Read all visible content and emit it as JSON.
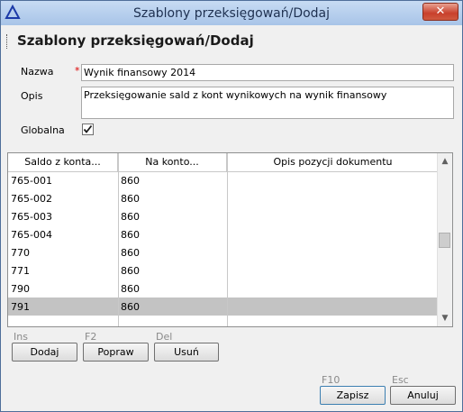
{
  "window": {
    "title": "Szablony przeksięgowań/Dodaj"
  },
  "page": {
    "title": "Szablony przeksięgowań/Dodaj"
  },
  "form": {
    "nazwa_label": "Nazwa",
    "required_mark": "*",
    "nazwa_value": "Wynik finansowy 2014",
    "opis_label": "Opis",
    "opis_value": "Przeksięgowanie sald z kont wynikowych na wynik finansowy",
    "globalna_label": "Globalna",
    "globalna_checked": true
  },
  "grid": {
    "columns": [
      "Saldo z konta...",
      "Na konto...",
      "Opis pozycji dokumentu"
    ],
    "rows": [
      {
        "saldo": "765-001",
        "na_konto": "860",
        "opis": ""
      },
      {
        "saldo": "765-002",
        "na_konto": "860",
        "opis": ""
      },
      {
        "saldo": "765-003",
        "na_konto": "860",
        "opis": ""
      },
      {
        "saldo": "765-004",
        "na_konto": "860",
        "opis": ""
      },
      {
        "saldo": "770",
        "na_konto": "860",
        "opis": ""
      },
      {
        "saldo": "771",
        "na_konto": "860",
        "opis": ""
      },
      {
        "saldo": "790",
        "na_konto": "860",
        "opis": ""
      },
      {
        "saldo": "791",
        "na_konto": "860",
        "opis": ""
      }
    ],
    "selected_row_index": 7
  },
  "grid_buttons": {
    "dodaj": {
      "key": "Ins",
      "label": "Dodaj"
    },
    "popraw": {
      "key": "F2",
      "label": "Popraw"
    },
    "usun": {
      "key": "Del",
      "label": "Usuń"
    }
  },
  "footer_buttons": {
    "zapisz": {
      "key": "F10",
      "label": "Zapisz"
    },
    "anuluj": {
      "key": "Esc",
      "label": "Anuluj"
    }
  },
  "colors": {
    "selected_row": "#c3c3c3",
    "required": "#dd0000",
    "title_bar": "#b4cdec"
  }
}
